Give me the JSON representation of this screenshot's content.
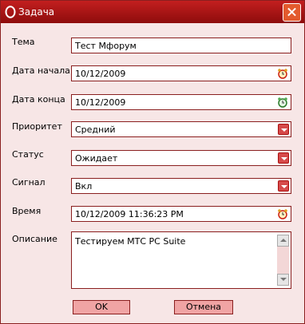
{
  "window": {
    "title": "Задача"
  },
  "form": {
    "topic": {
      "label": "Тема",
      "value": "Тест Мфорум"
    },
    "start_date": {
      "label": "Дата начала",
      "value": "10/12/2009"
    },
    "end_date": {
      "label": "Дата конца",
      "value": "10/12/2009"
    },
    "priority": {
      "label": "Приоритет",
      "value": "Средний"
    },
    "status": {
      "label": "Статус",
      "value": "Ожидает"
    },
    "signal": {
      "label": "Сигнал",
      "value": "Вкл"
    },
    "time": {
      "label": "Время",
      "value": "10/12/2009 11:36:23 PM"
    },
    "description": {
      "label": "Описание",
      "value": "Тестируем МТС PC Suite"
    }
  },
  "buttons": {
    "ok": "OK",
    "cancel": "Отмена"
  },
  "icons": {
    "title_logo": "opera-logo-icon",
    "close": "close-icon",
    "alarm": "alarm-clock-icon",
    "dropdown": "chevron-down-icon"
  },
  "colors": {
    "accent": "#a01414",
    "field_border": "#8a1f1f",
    "button_bg": "#f0a4a4"
  }
}
